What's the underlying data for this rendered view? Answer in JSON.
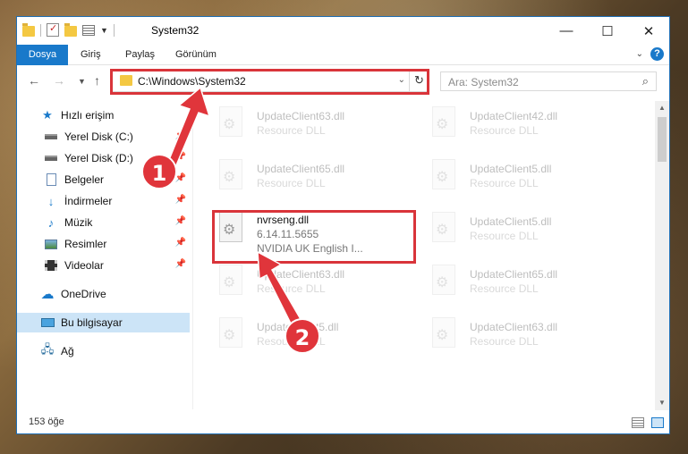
{
  "window": {
    "title": "System32",
    "controls": {
      "minimize": "—",
      "maximize": "☐",
      "close": "✕"
    }
  },
  "ribbon": {
    "tabs": [
      "Dosya",
      "Giriş",
      "Paylaş",
      "Görünüm"
    ]
  },
  "address": {
    "path": "C:\\Windows\\System32",
    "search_placeholder": "Ara: System32"
  },
  "sidebar": {
    "items": [
      {
        "label": "Hızlı erişim",
        "icon": "star-icon"
      },
      {
        "label": "Yerel Disk (C:)",
        "icon": "drive-icon",
        "pinned": true
      },
      {
        "label": "Yerel Disk (D:)",
        "icon": "drive-icon",
        "pinned": true
      },
      {
        "label": "Belgeler",
        "icon": "document-icon",
        "pinned": true
      },
      {
        "label": "İndirmeler",
        "icon": "download-icon",
        "pinned": true
      },
      {
        "label": "Müzik",
        "icon": "music-icon",
        "pinned": true
      },
      {
        "label": "Resimler",
        "icon": "pictures-icon",
        "pinned": true
      },
      {
        "label": "Videolar",
        "icon": "video-icon",
        "pinned": true
      },
      {
        "label": "OneDrive",
        "icon": "cloud-icon"
      },
      {
        "label": "Bu bilgisayar",
        "icon": "computer-icon",
        "selected": true
      },
      {
        "label": "Ağ",
        "icon": "network-icon"
      }
    ]
  },
  "files": [
    {
      "name": "UpdateClient63.dll",
      "type": "Resource DLL",
      "dim": true
    },
    {
      "name": "UpdateClient42.dll",
      "type": "Resource DLL",
      "dim": true
    },
    {
      "name": "UpdateClient65.dll",
      "type": "Resource DLL",
      "dim": true
    },
    {
      "name": "UpdateClient5.dll",
      "type": "Resource DLL",
      "dim": true
    },
    {
      "name": "nvrseng.dll",
      "version": "6.14.11.5655",
      "type": "NVIDIA UK English I...",
      "dim": false
    },
    {
      "name": "UpdateClient5.dll",
      "type": "Resource DLL",
      "dim": true
    },
    {
      "name": "UpdateClient63.dll",
      "type": "Resource DLL",
      "dim": true
    },
    {
      "name": "UpdateClient65.dll",
      "type": "Resource DLL",
      "dim": true
    },
    {
      "name": "UpdateClient5.dll",
      "type": "Resource DLL",
      "dim": true
    },
    {
      "name": "UpdateClient63.dll",
      "type": "Resource DLL",
      "dim": true
    }
  ],
  "status": {
    "count": "153 öğe"
  },
  "annotations": {
    "step1": "1",
    "step2": "2",
    "color": "#e0353b"
  }
}
